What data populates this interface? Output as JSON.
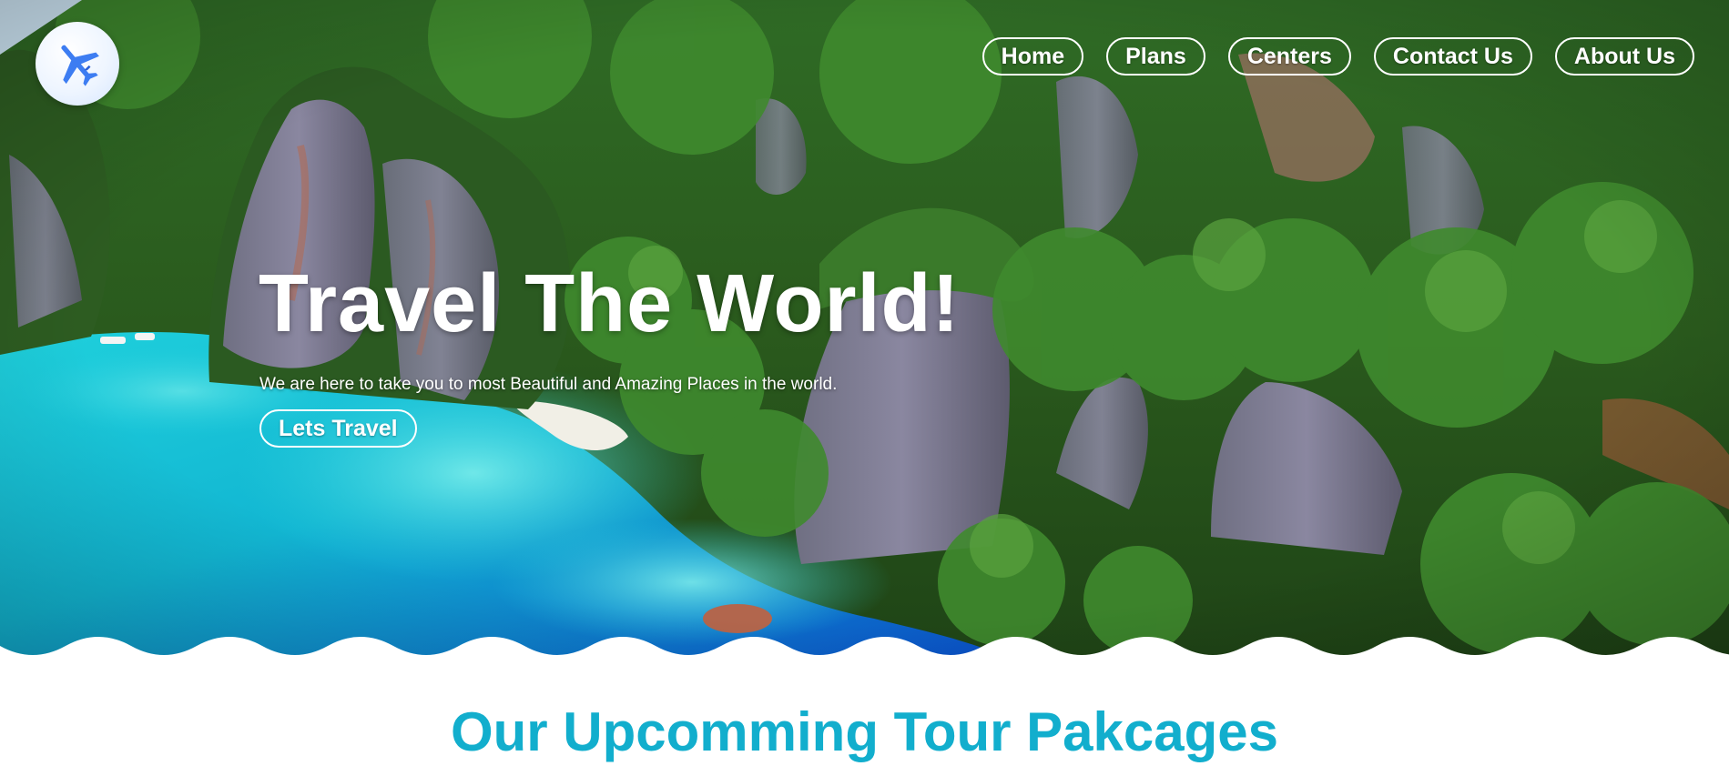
{
  "colors": {
    "accent": "#12aecd",
    "logo_plane": "#3d7df2",
    "sea": "#1ec9d8",
    "jungle": "#2c5a1e"
  },
  "logo": {
    "icon": "airplane-icon"
  },
  "nav": {
    "items": [
      {
        "label": "Home"
      },
      {
        "label": "Plans"
      },
      {
        "label": "Centers"
      },
      {
        "label": "Contact Us"
      },
      {
        "label": "About Us"
      }
    ]
  },
  "hero": {
    "title": "Travel The World!",
    "subtitle": "We are here to take you to most Beautiful and Amazing Places in the world.",
    "cta_label": "Lets Travel"
  },
  "packages": {
    "heading": "Our Upcomming Tour Pakcages"
  }
}
